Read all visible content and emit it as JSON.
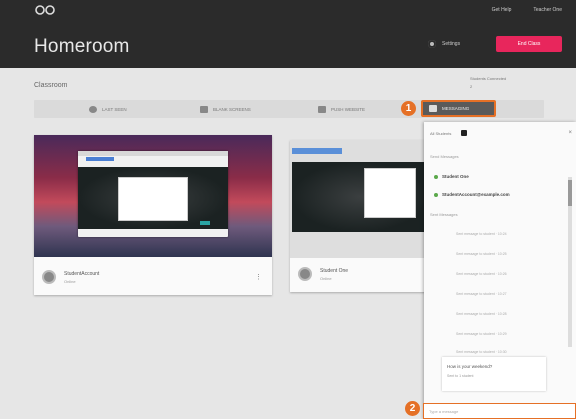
{
  "header": {
    "app_title": "Homeroom",
    "top_links": [
      "Get Help",
      "Teacher One"
    ],
    "settings_label": "Settings",
    "end_class_label": "End Class"
  },
  "classroom": {
    "label": "Classroom",
    "student_count_label": "Students Connected",
    "student_count_value": "2"
  },
  "toolbar": {
    "items": [
      {
        "label": "LAST SEEN",
        "icon": "clock-icon"
      },
      {
        "label": "BLANK SCREENS",
        "icon": "screen-icon"
      },
      {
        "label": "PUSH WEBSITE",
        "icon": "push-icon"
      }
    ],
    "messaging_label": "MESSAGING"
  },
  "callouts": {
    "one": "1",
    "two": "2"
  },
  "students": [
    {
      "name": "StudentAccount",
      "detail": "Online",
      "more": "⋮"
    },
    {
      "name": "Student One",
      "detail": "Online"
    }
  ],
  "panel": {
    "header_label": "All Students",
    "close": "×",
    "section_students": "Send Messages",
    "entries": [
      "Student One",
      "StudentAccount@example.com"
    ],
    "section_history": "Sent Messages",
    "message_labels": [
      "Sent message to student · 10:24",
      "Sent message to student · 10:25",
      "Sent message to student · 10:26",
      "Sent message to student · 10:27",
      "Sent message to student · 10:28",
      "Sent message to student · 10:29",
      "Sent message to student · 10:30"
    ],
    "grade_question": "How is your weekend?",
    "grade_sub": "Sent to 1 student",
    "compose_placeholder": "Type a message"
  },
  "colors": {
    "accent": "#e57026",
    "end_class": "#e8265c",
    "header": "#2b2b2b"
  }
}
